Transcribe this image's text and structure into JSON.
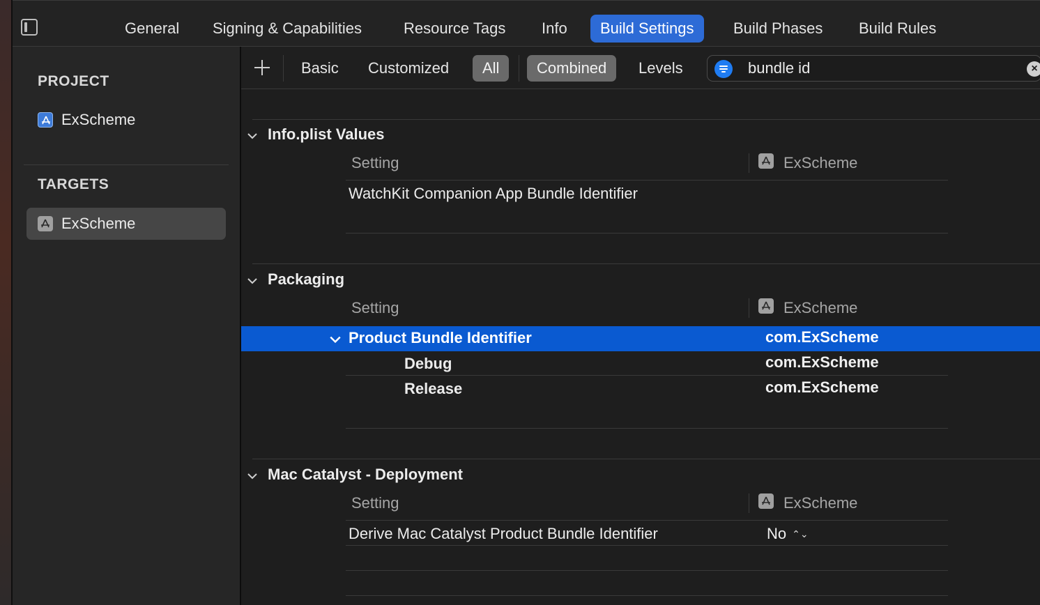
{
  "tabs": [
    "General",
    "Signing & Capabilities",
    "Resource Tags",
    "Info",
    "Build Settings",
    "Build Phases",
    "Build Rules"
  ],
  "active_tab": "Build Settings",
  "sidebar": {
    "project_header": "PROJECT",
    "project_item": "ExScheme",
    "targets_header": "TARGETS",
    "target_item": "ExScheme"
  },
  "filterbar": {
    "scope": [
      "Basic",
      "Customized",
      "All"
    ],
    "view": [
      "Combined",
      "Levels"
    ],
    "selected_scope": "All",
    "selected_view": "Combined",
    "search_value": "bundle id"
  },
  "sections": [
    {
      "title": "Info.plist Values",
      "column_setting": "Setting",
      "column_target": "ExScheme",
      "rows": [
        {
          "name": "WatchKit Companion App Bundle Identifier",
          "value": ""
        }
      ]
    },
    {
      "title": "Packaging",
      "column_setting": "Setting",
      "column_target": "ExScheme",
      "rows": [
        {
          "name": "Product Bundle Identifier",
          "value": "com.ExScheme",
          "selected": true,
          "expanded": true
        },
        {
          "name": "Debug",
          "value": "com.ExScheme"
        },
        {
          "name": "Release",
          "value": "com.ExScheme"
        }
      ]
    },
    {
      "title": "Mac Catalyst - Deployment",
      "column_setting": "Setting",
      "column_target": "ExScheme",
      "rows": [
        {
          "name": "Derive Mac Catalyst Product Bundle Identifier",
          "value": "No"
        }
      ]
    }
  ],
  "colors": {
    "accent": "#2d6bd6",
    "selection": "#0a5ad1",
    "search_filter": "#1f7cf2"
  }
}
